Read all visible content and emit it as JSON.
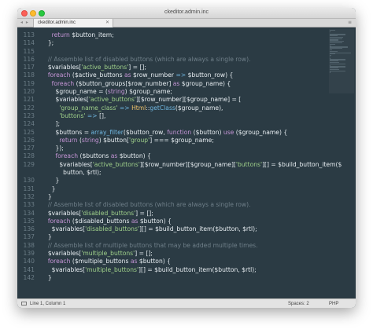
{
  "window": {
    "title": "ckeditor.admin.inc"
  },
  "tabbar": {
    "nav_arrows": "◂ ▸",
    "tab_label": "ckeditor.admin.inc",
    "tab_close": "✕",
    "menu_glyph": "≡"
  },
  "editor": {
    "lines": [
      {
        "n": "113",
        "tokens": [
          [
            "pl",
            "    "
          ],
          [
            "kw",
            "return "
          ],
          [
            "var",
            "$button_item"
          ],
          [
            "pl",
            ";"
          ]
        ]
      },
      {
        "n": "114",
        "tokens": [
          [
            "pl",
            "  };"
          ]
        ]
      },
      {
        "n": "115",
        "tokens": []
      },
      {
        "n": "116",
        "tokens": [
          [
            "pl",
            "  "
          ],
          [
            "cm",
            "// Assemble list of disabled buttons (which are always a single row)."
          ]
        ]
      },
      {
        "n": "117",
        "tokens": [
          [
            "pl",
            "  "
          ],
          [
            "var",
            "$variables"
          ],
          [
            "pl",
            "["
          ],
          [
            "str",
            "'active_buttons'"
          ],
          [
            "pl",
            "] = [];"
          ]
        ]
      },
      {
        "n": "118",
        "tokens": [
          [
            "pl",
            "  "
          ],
          [
            "kw",
            "foreach"
          ],
          [
            "pl",
            " ("
          ],
          [
            "var",
            "$active_buttons"
          ],
          [
            "kw",
            " as "
          ],
          [
            "var",
            "$row_number"
          ],
          [
            "op",
            " => "
          ],
          [
            "var",
            "$button_row"
          ],
          [
            "pl",
            ") {"
          ]
        ]
      },
      {
        "n": "119",
        "tokens": [
          [
            "pl",
            "    "
          ],
          [
            "kw",
            "foreach"
          ],
          [
            "pl",
            " ("
          ],
          [
            "var",
            "$button_groups"
          ],
          [
            "pl",
            "["
          ],
          [
            "var",
            "$row_number"
          ],
          [
            "pl",
            "]"
          ],
          [
            "kw",
            " as "
          ],
          [
            "var",
            "$group_name"
          ],
          [
            "pl",
            ") {"
          ]
        ]
      },
      {
        "n": "120",
        "tokens": [
          [
            "pl",
            "      "
          ],
          [
            "var",
            "$group_name"
          ],
          [
            "pl",
            " = ("
          ],
          [
            "kw",
            "string"
          ],
          [
            "pl",
            ") "
          ],
          [
            "var",
            "$group_name"
          ],
          [
            "pl",
            ";"
          ]
        ]
      },
      {
        "n": "121",
        "tokens": [
          [
            "pl",
            "      "
          ],
          [
            "var",
            "$variables"
          ],
          [
            "pl",
            "["
          ],
          [
            "str",
            "'active_buttons'"
          ],
          [
            "pl",
            "]["
          ],
          [
            "var",
            "$row_number"
          ],
          [
            "pl",
            "]["
          ],
          [
            "var",
            "$group_name"
          ],
          [
            "pl",
            "] = ["
          ]
        ]
      },
      {
        "n": "122",
        "tokens": [
          [
            "pl",
            "        "
          ],
          [
            "str",
            "'group_name_class'"
          ],
          [
            "op",
            " => "
          ],
          [
            "cls",
            "Html"
          ],
          [
            "pl",
            "::"
          ],
          [
            "fn",
            "getClass"
          ],
          [
            "pl",
            "("
          ],
          [
            "var",
            "$group_name"
          ],
          [
            "pl",
            "),"
          ]
        ]
      },
      {
        "n": "123",
        "tokens": [
          [
            "pl",
            "        "
          ],
          [
            "str",
            "'buttons'"
          ],
          [
            "op",
            " => "
          ],
          [
            "pl",
            "[],"
          ]
        ]
      },
      {
        "n": "124",
        "tokens": [
          [
            "pl",
            "      ];"
          ]
        ]
      },
      {
        "n": "125",
        "tokens": [
          [
            "pl",
            "      "
          ],
          [
            "var",
            "$buttons"
          ],
          [
            "pl",
            " = "
          ],
          [
            "fn",
            "array_filter"
          ],
          [
            "pl",
            "("
          ],
          [
            "var",
            "$button_row"
          ],
          [
            "pl",
            ", "
          ],
          [
            "kw",
            "function"
          ],
          [
            "pl",
            " ("
          ],
          [
            "var",
            "$button"
          ],
          [
            "pl",
            ") "
          ],
          [
            "kw",
            "use"
          ],
          [
            "pl",
            " ("
          ],
          [
            "var",
            "$group_name"
          ],
          [
            "pl",
            ") {"
          ]
        ]
      },
      {
        "n": "126",
        "tokens": [
          [
            "pl",
            "        "
          ],
          [
            "kw",
            "return"
          ],
          [
            "pl",
            " ("
          ],
          [
            "kw",
            "string"
          ],
          [
            "pl",
            ") "
          ],
          [
            "var",
            "$button"
          ],
          [
            "pl",
            "["
          ],
          [
            "str",
            "'group'"
          ],
          [
            "pl",
            "] === "
          ],
          [
            "var",
            "$group_name"
          ],
          [
            "pl",
            ";"
          ]
        ]
      },
      {
        "n": "127",
        "tokens": [
          [
            "pl",
            "      });"
          ]
        ]
      },
      {
        "n": "128",
        "tokens": [
          [
            "pl",
            "      "
          ],
          [
            "kw",
            "foreach"
          ],
          [
            "pl",
            " ("
          ],
          [
            "var",
            "$buttons"
          ],
          [
            "kw",
            " as "
          ],
          [
            "var",
            "$button"
          ],
          [
            "pl",
            ") {"
          ]
        ]
      },
      {
        "n": "129",
        "tokens": [
          [
            "pl",
            "        "
          ],
          [
            "var",
            "$variables"
          ],
          [
            "pl",
            "["
          ],
          [
            "str",
            "'active_buttons'"
          ],
          [
            "pl",
            "]["
          ],
          [
            "var",
            "$row_number"
          ],
          [
            "pl",
            "]["
          ],
          [
            "var",
            "$group_name"
          ],
          [
            "pl",
            "]["
          ],
          [
            "str",
            "'buttons'"
          ],
          [
            "pl",
            "][] = "
          ],
          [
            "var",
            "$build_button_item"
          ],
          [
            "pl",
            "($"
          ]
        ]
      },
      {
        "n": "",
        "tokens": [
          [
            "pl",
            "          "
          ],
          [
            "var",
            "button"
          ],
          [
            "pl",
            ", "
          ],
          [
            "var",
            "$rtl"
          ],
          [
            "pl",
            ");"
          ]
        ]
      },
      {
        "n": "130",
        "tokens": [
          [
            "pl",
            "      }"
          ]
        ]
      },
      {
        "n": "131",
        "tokens": [
          [
            "pl",
            "    }"
          ]
        ]
      },
      {
        "n": "132",
        "tokens": [
          [
            "pl",
            "  }"
          ]
        ]
      },
      {
        "n": "133",
        "tokens": [
          [
            "pl",
            "  "
          ],
          [
            "cm",
            "// Assemble list of disabled buttons (which are always a single row)."
          ]
        ]
      },
      {
        "n": "134",
        "tokens": [
          [
            "pl",
            "  "
          ],
          [
            "var",
            "$variables"
          ],
          [
            "pl",
            "["
          ],
          [
            "str",
            "'disabled_buttons'"
          ],
          [
            "pl",
            "] = [];"
          ]
        ]
      },
      {
        "n": "135",
        "tokens": [
          [
            "pl",
            "  "
          ],
          [
            "kw",
            "foreach"
          ],
          [
            "pl",
            " ("
          ],
          [
            "var",
            "$disabled_buttons"
          ],
          [
            "kw",
            " as "
          ],
          [
            "var",
            "$button"
          ],
          [
            "pl",
            ") {"
          ]
        ]
      },
      {
        "n": "136",
        "tokens": [
          [
            "pl",
            "    "
          ],
          [
            "var",
            "$variables"
          ],
          [
            "pl",
            "["
          ],
          [
            "str",
            "'disabled_buttons'"
          ],
          [
            "pl",
            "][] = "
          ],
          [
            "var",
            "$build_button_item"
          ],
          [
            "pl",
            "("
          ],
          [
            "var",
            "$button"
          ],
          [
            "pl",
            ", "
          ],
          [
            "var",
            "$rtl"
          ],
          [
            "pl",
            ");"
          ]
        ]
      },
      {
        "n": "137",
        "tokens": [
          [
            "pl",
            "  }"
          ]
        ]
      },
      {
        "n": "138",
        "tokens": [
          [
            "pl",
            "  "
          ],
          [
            "cm",
            "// Assemble list of multiple buttons that may be added multiple times."
          ]
        ]
      },
      {
        "n": "139",
        "tokens": [
          [
            "pl",
            "  "
          ],
          [
            "var",
            "$variables"
          ],
          [
            "pl",
            "["
          ],
          [
            "str",
            "'multiple_buttons'"
          ],
          [
            "pl",
            "] = [];"
          ]
        ]
      },
      {
        "n": "140",
        "tokens": [
          [
            "pl",
            "  "
          ],
          [
            "kw",
            "foreach"
          ],
          [
            "pl",
            " ("
          ],
          [
            "var",
            "$multiple_buttons"
          ],
          [
            "kw",
            " as "
          ],
          [
            "var",
            "$button"
          ],
          [
            "pl",
            ") {"
          ]
        ]
      },
      {
        "n": "141",
        "tokens": [
          [
            "pl",
            "    "
          ],
          [
            "var",
            "$variables"
          ],
          [
            "pl",
            "["
          ],
          [
            "str",
            "'multiple_buttons'"
          ],
          [
            "pl",
            "][] = "
          ],
          [
            "var",
            "$build_button_item"
          ],
          [
            "pl",
            "("
          ],
          [
            "var",
            "$button"
          ],
          [
            "pl",
            ", "
          ],
          [
            "var",
            "$rtl"
          ],
          [
            "pl",
            ");"
          ]
        ]
      },
      {
        "n": "142",
        "tokens": [
          [
            "pl",
            "  }"
          ]
        ]
      }
    ]
  },
  "status": {
    "position": "Line 1, Column 1",
    "spaces": "Spaces: 2",
    "syntax": "PHP"
  },
  "colors": {
    "editor_bg": "#2b3b44",
    "keyword": "#c595d6",
    "string": "#9fd08a",
    "comment": "#6f7f89",
    "function": "#6fb6e0",
    "class": "#f1c36b",
    "line_number": "#6b7c86"
  }
}
